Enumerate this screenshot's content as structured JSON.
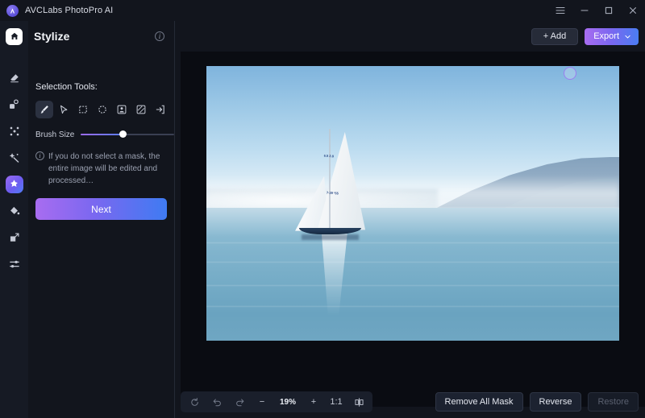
{
  "titlebar": {
    "app_name": "AVCLabs PhotoPro AI",
    "logo_icon": "app-logo-icon",
    "controls": [
      {
        "name": "menu-icon",
        "glyph": "☰"
      },
      {
        "name": "minimize-icon",
        "glyph": "−"
      },
      {
        "name": "maximize-icon",
        "glyph": "□"
      },
      {
        "name": "close-icon",
        "glyph": "✕"
      }
    ]
  },
  "rail": {
    "home_icon": "home-icon",
    "items": [
      {
        "name": "rail-item-erase",
        "icon": "eraser-icon",
        "active": false
      },
      {
        "name": "rail-item-replace",
        "icon": "object-replace-icon",
        "active": false
      },
      {
        "name": "rail-item-expand",
        "icon": "expand-icon",
        "active": false
      },
      {
        "name": "rail-item-enhance",
        "icon": "magic-wand-icon",
        "active": false
      },
      {
        "name": "rail-item-stylize",
        "icon": "stylize-icon",
        "active": true
      },
      {
        "name": "rail-item-colorize",
        "icon": "paint-bucket-icon",
        "active": false
      },
      {
        "name": "rail-item-upscale",
        "icon": "upscale-icon",
        "active": false
      },
      {
        "name": "rail-item-adjust",
        "icon": "sliders-icon",
        "active": false
      }
    ]
  },
  "panel": {
    "title": "Stylize",
    "info_icon": "info-icon",
    "section_label": "Selection Tools:",
    "tools": [
      {
        "name": "tool-brush",
        "icon": "brush-icon",
        "active": true
      },
      {
        "name": "tool-pointer",
        "icon": "cursor-icon",
        "active": false
      },
      {
        "name": "tool-rectangle",
        "icon": "rectangle-select-icon",
        "active": false
      },
      {
        "name": "tool-ellipse",
        "icon": "ellipse-select-icon",
        "active": false
      },
      {
        "name": "tool-subject",
        "icon": "subject-select-icon",
        "active": false
      },
      {
        "name": "tool-background",
        "icon": "background-select-icon",
        "active": false
      },
      {
        "name": "tool-import-mask",
        "icon": "import-mask-icon",
        "active": false
      }
    ],
    "brush_size_label": "Brush Size",
    "brush_size_value": "45",
    "hint_text": "If you do not select a mask, the entire image will be edited and processed…",
    "next_label": "Next"
  },
  "topbar": {
    "add_label": "+ Add",
    "export_label": "Export",
    "export_chevron": "chevron-down-icon"
  },
  "canvas": {
    "zoom_level": "19%",
    "fit_label": "1:1",
    "buttons": {
      "reset": "reset-icon",
      "undo": "undo-icon",
      "redo": "redo-icon",
      "zoom_out": "−",
      "zoom_in": "+",
      "compare": "compare-split-icon"
    },
    "brush_cursor": "brush-cursor",
    "image": {
      "alt": "sailboat on calm lake with mountains",
      "sail_number_top": "6.5\n2.8",
      "sail_number_bottom": "7·39\n¹55"
    }
  },
  "actions": {
    "remove_all_mask": "Remove All Mask",
    "reverse": "Reverse",
    "restore": "Restore"
  },
  "colors": {
    "accent_purple": "#8a6bf0",
    "accent_blue": "#4a7df2",
    "panel_bg": "#12151d",
    "rail_bg": "#161a24",
    "canvas_bg": "#0a0c12"
  }
}
